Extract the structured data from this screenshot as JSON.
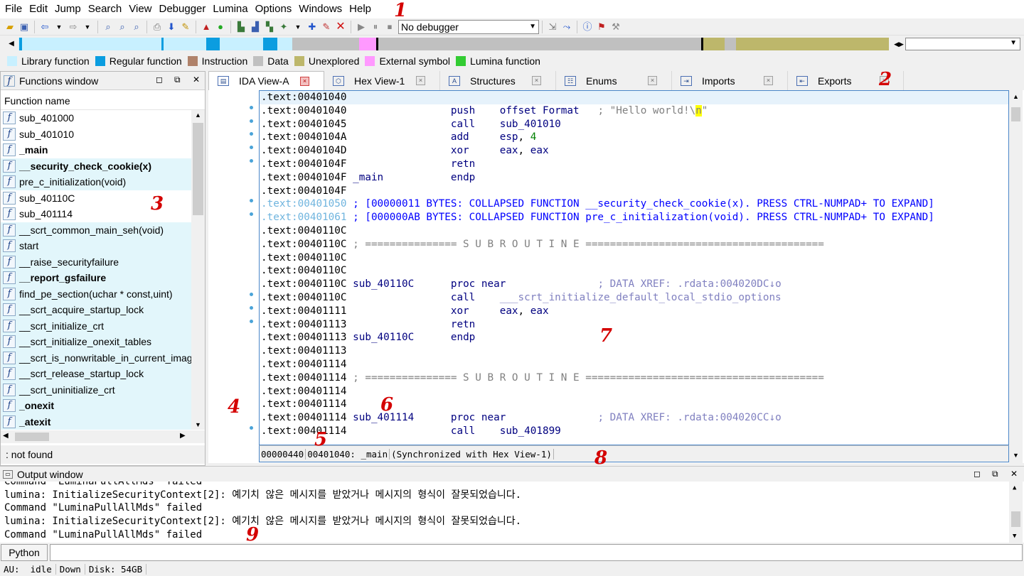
{
  "menu": [
    "File",
    "Edit",
    "Jump",
    "Search",
    "View",
    "Debugger",
    "Lumina",
    "Options",
    "Windows",
    "Help"
  ],
  "annotations": [
    "1",
    "2",
    "3",
    "4",
    "5",
    "6",
    "7",
    "8",
    "9"
  ],
  "toolbar": {
    "debugger_select": "No debugger"
  },
  "legend": [
    {
      "label": "Library function",
      "color": "#c8f0ff"
    },
    {
      "label": "Regular function",
      "color": "#0b9de0"
    },
    {
      "label": "Instruction",
      "color": "#b0826a"
    },
    {
      "label": "Data",
      "color": "#c0c0c0"
    },
    {
      "label": "Unexplored",
      "color": "#bdb76b"
    },
    {
      "label": "External symbol",
      "color": "#ff99ff"
    },
    {
      "label": "Lumina function",
      "color": "#33cc33"
    }
  ],
  "functions_window": {
    "title": "Functions window",
    "column": "Function name",
    "icon_glyph": "f",
    "items": [
      {
        "name": "sub_401000",
        "bold": false,
        "hl": false
      },
      {
        "name": "sub_401010",
        "bold": false,
        "hl": false
      },
      {
        "name": "_main",
        "bold": true,
        "hl": false
      },
      {
        "name": "__security_check_cookie(x)",
        "bold": true,
        "hl": true
      },
      {
        "name": "pre_c_initialization(void)",
        "bold": false,
        "hl": true
      },
      {
        "name": "sub_40110C",
        "bold": false,
        "hl": false
      },
      {
        "name": "sub_401114",
        "bold": false,
        "hl": false
      },
      {
        "name": "__scrt_common_main_seh(void)",
        "bold": false,
        "hl": true
      },
      {
        "name": "start",
        "bold": false,
        "hl": true
      },
      {
        "name": "__raise_securityfailure",
        "bold": false,
        "hl": true
      },
      {
        "name": "__report_gsfailure",
        "bold": true,
        "hl": true
      },
      {
        "name": "find_pe_section(uchar * const,uint)",
        "bold": false,
        "hl": true
      },
      {
        "name": "__scrt_acquire_startup_lock",
        "bold": false,
        "hl": true
      },
      {
        "name": "__scrt_initialize_crt",
        "bold": false,
        "hl": true
      },
      {
        "name": "__scrt_initialize_onexit_tables",
        "bold": false,
        "hl": true
      },
      {
        "name": "__scrt_is_nonwritable_in_current_imag",
        "bold": false,
        "hl": true
      },
      {
        "name": "__scrt_release_startup_lock",
        "bold": false,
        "hl": true
      },
      {
        "name": "__scrt_uninitialize_crt",
        "bold": false,
        "hl": true
      },
      {
        "name": "_onexit",
        "bold": true,
        "hl": true
      },
      {
        "name": "_atexit",
        "bold": true,
        "hl": true
      }
    ],
    "status": ": not found"
  },
  "tabs": [
    {
      "label": "IDA View-A",
      "active": true
    },
    {
      "label": "Hex View-1",
      "active": false
    },
    {
      "label": "Structures",
      "active": false
    },
    {
      "label": "Enums",
      "active": false
    },
    {
      "label": "Imports",
      "active": false
    },
    {
      "label": "Exports",
      "active": false
    }
  ],
  "code_lines": [
    ".text:00401040",
    ".text:00401040                 push    offset Format   ; \"Hello world!\\n\"",
    ".text:00401045                 call    sub_401010",
    ".text:0040104A                 add     esp, 4",
    ".text:0040104D                 xor     eax, eax",
    ".text:0040104F                 retn",
    ".text:0040104F _main           endp",
    ".text:0040104F",
    ".text:00401050 ; [00000011 BYTES: COLLAPSED FUNCTION __security_check_cookie(x). PRESS CTRL-NUMPAD+ TO EXPAND]",
    ".text:00401061 ; [000000AB BYTES: COLLAPSED FUNCTION pre_c_initialization(void). PRESS CTRL-NUMPAD+ TO EXPAND]",
    ".text:0040110C",
    ".text:0040110C ; =============== S U B R O U T I N E =======================================",
    ".text:0040110C",
    ".text:0040110C",
    ".text:0040110C sub_40110C      proc near               ; DATA XREF: .rdata:004020DC↓o",
    ".text:0040110C                 call    ___scrt_initialize_default_local_stdio_options",
    ".text:00401111                 xor     eax, eax",
    ".text:00401113                 retn",
    ".text:00401113 sub_40110C      endp",
    ".text:00401113",
    ".text:00401114",
    ".text:00401114 ; =============== S U B R O U T I N E =======================================",
    ".text:00401114",
    ".text:00401114",
    ".text:00401114 sub_401114      proc near               ; DATA XREF: .rdata:004020CC↓o",
    ".text:00401114                 call    sub_401899"
  ],
  "code_status": [
    "00000440",
    "00401040: _main",
    "(Synchronized with Hex View-1)"
  ],
  "output_window": {
    "title": "Output window",
    "lines": [
      "Command \"LuminaPullAllMds\" failed",
      "lumina: InitializeSecurityContext[2]: 예기치 않은 메시지를 받았거나 메시지의 형식이 잘못되었습니다.",
      "Command \"LuminaPullAllMds\" failed",
      "lumina: InitializeSecurityContext[2]: 예기치 않은 메시지를 받았거나 메시지의 형식이 잘못되었습니다.",
      "Command \"LuminaPullAllMds\" failed"
    ]
  },
  "cmd": {
    "lang_button": "Python"
  },
  "statusbar": [
    "AU:  idle",
    "Down",
    "Disk: 54GB"
  ]
}
